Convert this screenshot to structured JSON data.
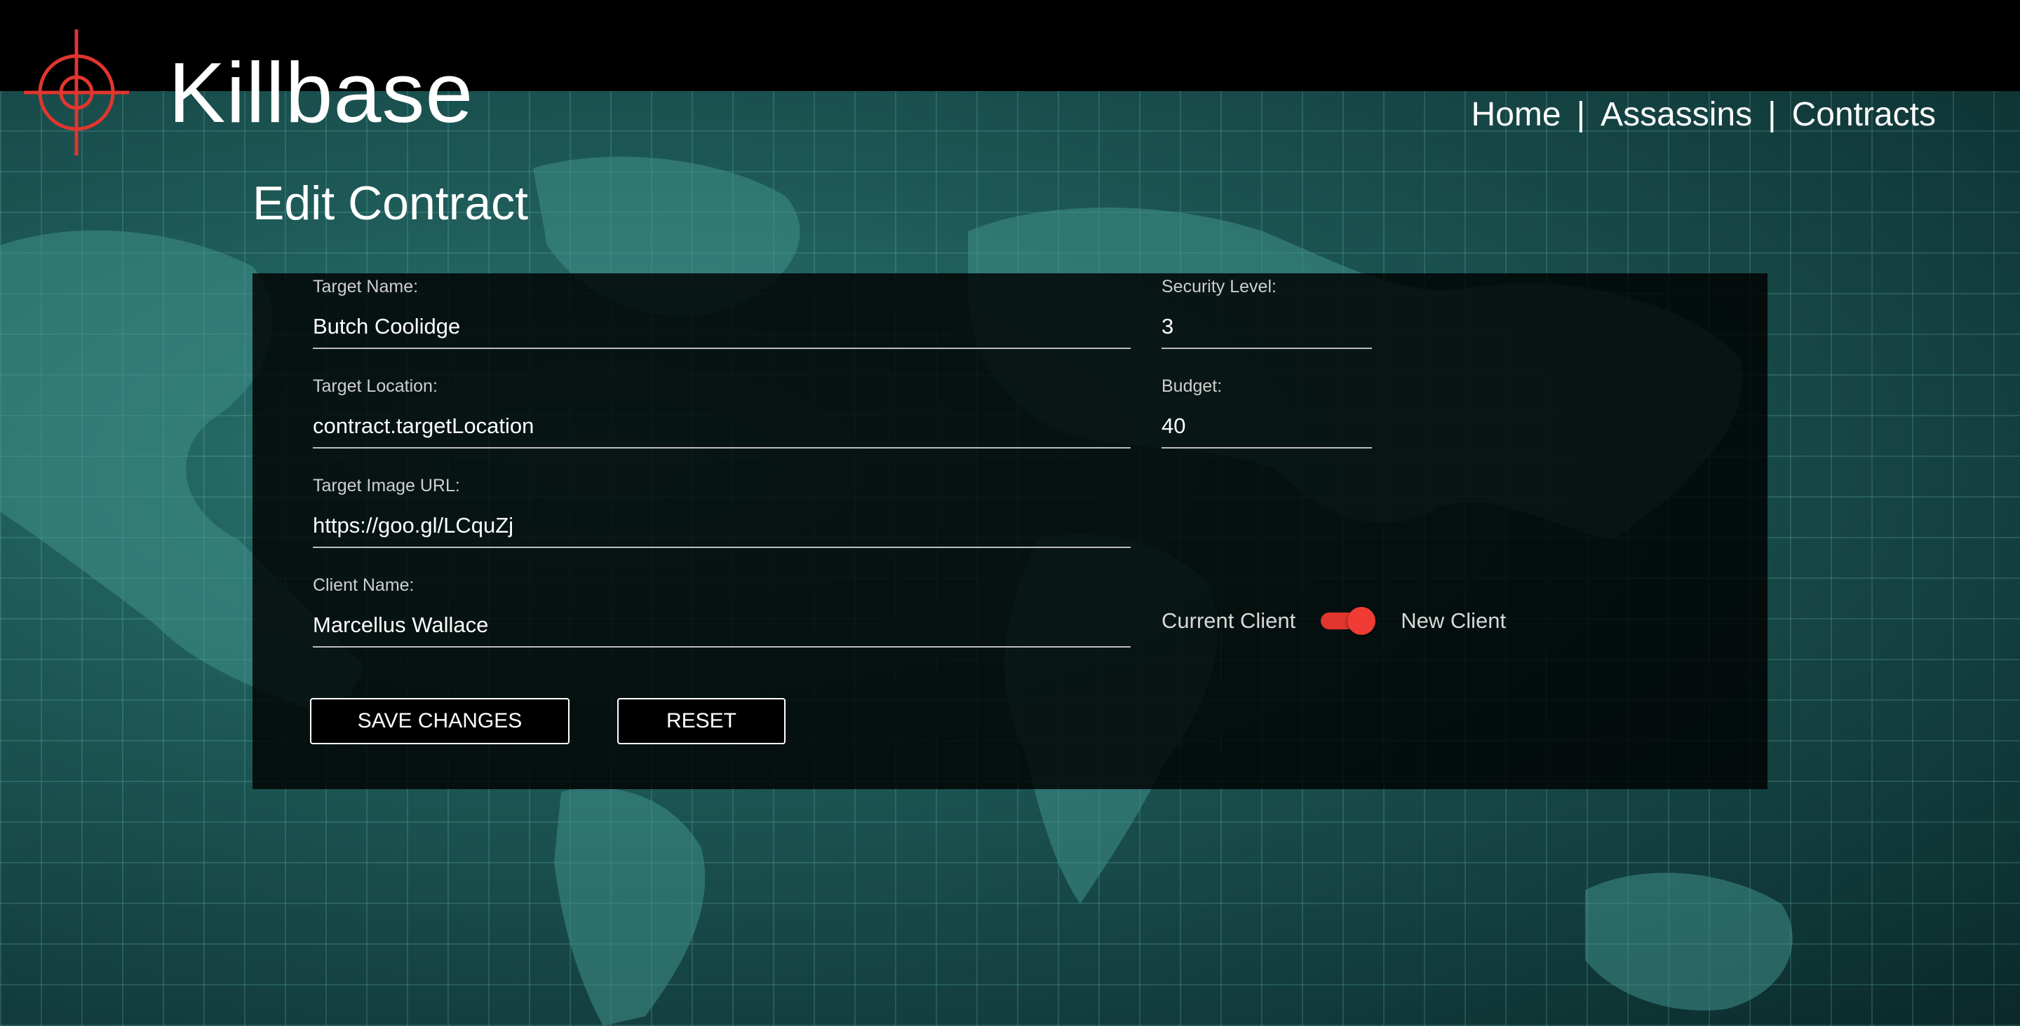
{
  "app": {
    "title": "Killbase",
    "accent_color": "#e0362f"
  },
  "nav": {
    "home": "Home",
    "assassins": "Assassins",
    "contracts": "Contracts",
    "separator": "|"
  },
  "page": {
    "title": "Edit Contract"
  },
  "form": {
    "target_name": {
      "label": "Target Name:",
      "value": "Butch Coolidge"
    },
    "security_level": {
      "label": "Security Level:",
      "value": "3"
    },
    "target_location": {
      "label": "Target Location:",
      "value": "contract.targetLocation"
    },
    "budget": {
      "label": "Budget:",
      "value": "40"
    },
    "target_image_url": {
      "label": "Target Image URL:",
      "value": "https://goo.gl/LCquZj"
    },
    "client_name": {
      "label": "Client Name:",
      "value": "Marcellus Wallace"
    },
    "client_toggle": {
      "left_label": "Current Client",
      "right_label": "New Client",
      "state": "on"
    },
    "buttons": {
      "save": "SAVE CHANGES",
      "reset": "RESET"
    }
  },
  "icons": {
    "logo": "crosshair-icon"
  }
}
